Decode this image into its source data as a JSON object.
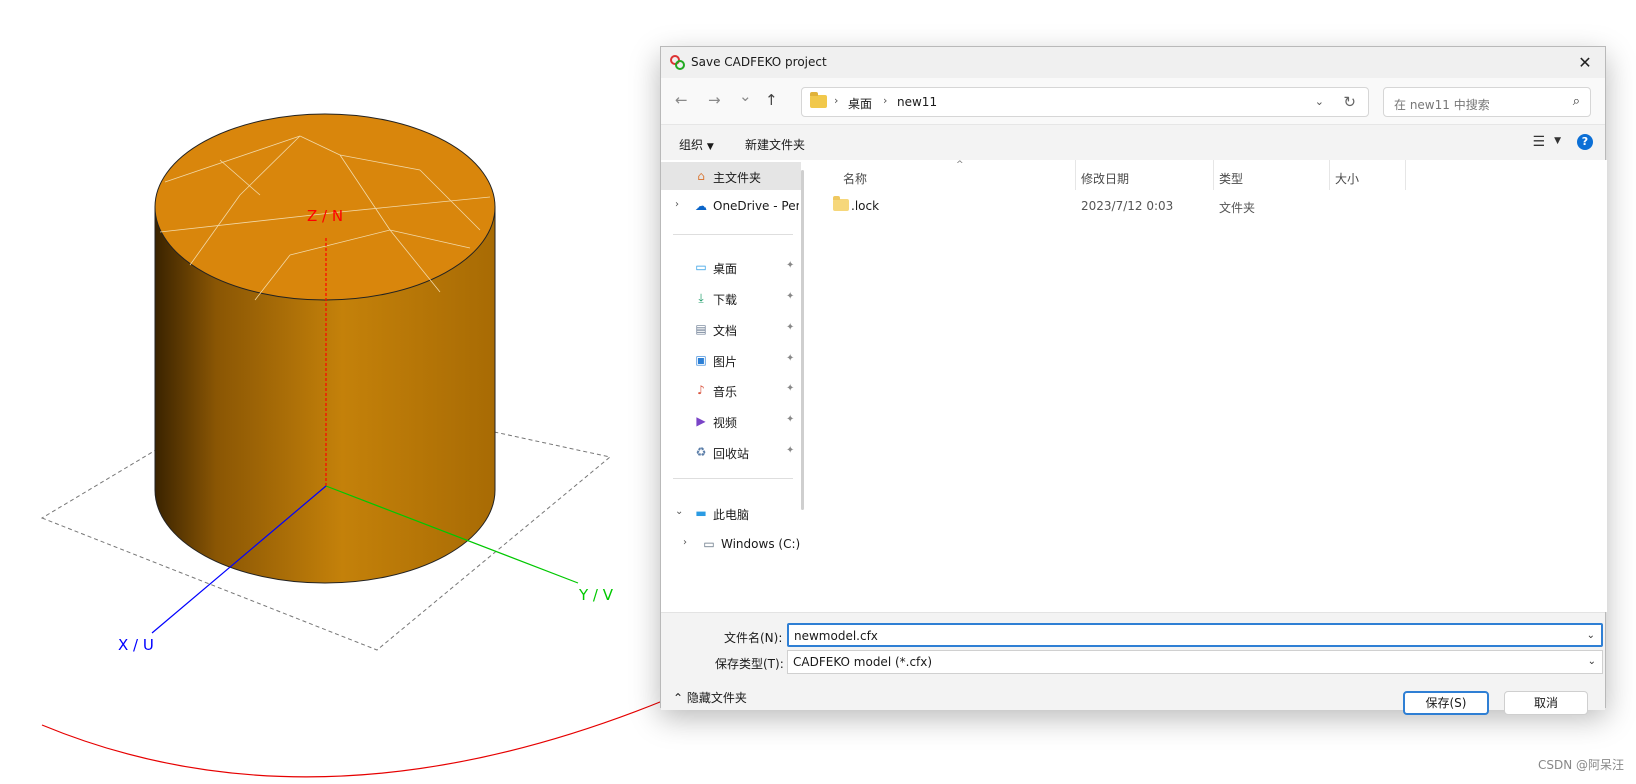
{
  "scene": {
    "axis_labels": {
      "z": "Z / N",
      "y": "Y / V",
      "x": "X / U"
    }
  },
  "dialog": {
    "title": "Save CADFEKO project",
    "close_icon": "close-icon",
    "nav": {
      "back": "←",
      "forward": "→",
      "recent": "⌄",
      "up": "↑",
      "breadcrumb": [
        "桌面",
        "new11"
      ],
      "search_placeholder": "在 new11 中搜索"
    },
    "toolbar": {
      "organize": "组织",
      "new_folder": "新建文件夹",
      "help": "?"
    },
    "sidebar": {
      "items": [
        {
          "label": "主文件夹",
          "icon": "home-icon",
          "glyph": "⌂",
          "color": "#d97a3a"
        },
        {
          "label": "OneDrive - Per",
          "icon": "cloud-icon",
          "glyph": "☁",
          "color": "#0a64c8"
        },
        {
          "label": "桌面",
          "icon": "desktop-icon",
          "glyph": "▭",
          "color": "#2b9be3"
        },
        {
          "label": "下载",
          "icon": "download-icon",
          "glyph": "⤓",
          "color": "#1e9c6a"
        },
        {
          "label": "文档",
          "icon": "document-icon",
          "glyph": "▤",
          "color": "#6b7b93"
        },
        {
          "label": "图片",
          "icon": "image-icon",
          "glyph": "▣",
          "color": "#2b7fd6"
        },
        {
          "label": "音乐",
          "icon": "music-icon",
          "glyph": "♪",
          "color": "#d9553f"
        },
        {
          "label": "视频",
          "icon": "video-icon",
          "glyph": "▶",
          "color": "#7a44c7"
        },
        {
          "label": "回收站",
          "icon": "recycle-bin-icon",
          "glyph": "♻",
          "color": "#5a7da8"
        },
        {
          "label": "此电脑",
          "icon": "computer-icon",
          "glyph": "▬",
          "color": "#2b9be3"
        },
        {
          "label": "Windows (C:)",
          "icon": "drive-icon",
          "glyph": "▭",
          "color": "#607080"
        }
      ],
      "pin_glyph": "📌"
    },
    "columns": [
      "名称",
      "修改日期",
      "类型",
      "大小"
    ],
    "files": [
      {
        "name": ".lock",
        "date": "2023/7/12 0:03",
        "type": "文件夹",
        "size": ""
      }
    ],
    "filename_label": "文件名(N):",
    "filename_value": "newmodel.cfx",
    "filetype_label": "保存类型(T):",
    "filetype_value": "CADFEKO model (*.cfx)",
    "save_button": "保存(S)",
    "cancel_button": "取消",
    "hide_folders": "隐藏文件夹"
  },
  "watermark": "CSDN @阿呆汪",
  "colors": {
    "cylinder_body": "#c4810a",
    "cylinder_top": "#d9860c",
    "z_axis": "#ff0000",
    "y_axis": "#00c800",
    "x_axis": "#0000ff",
    "accent": "#2f7fd4"
  }
}
